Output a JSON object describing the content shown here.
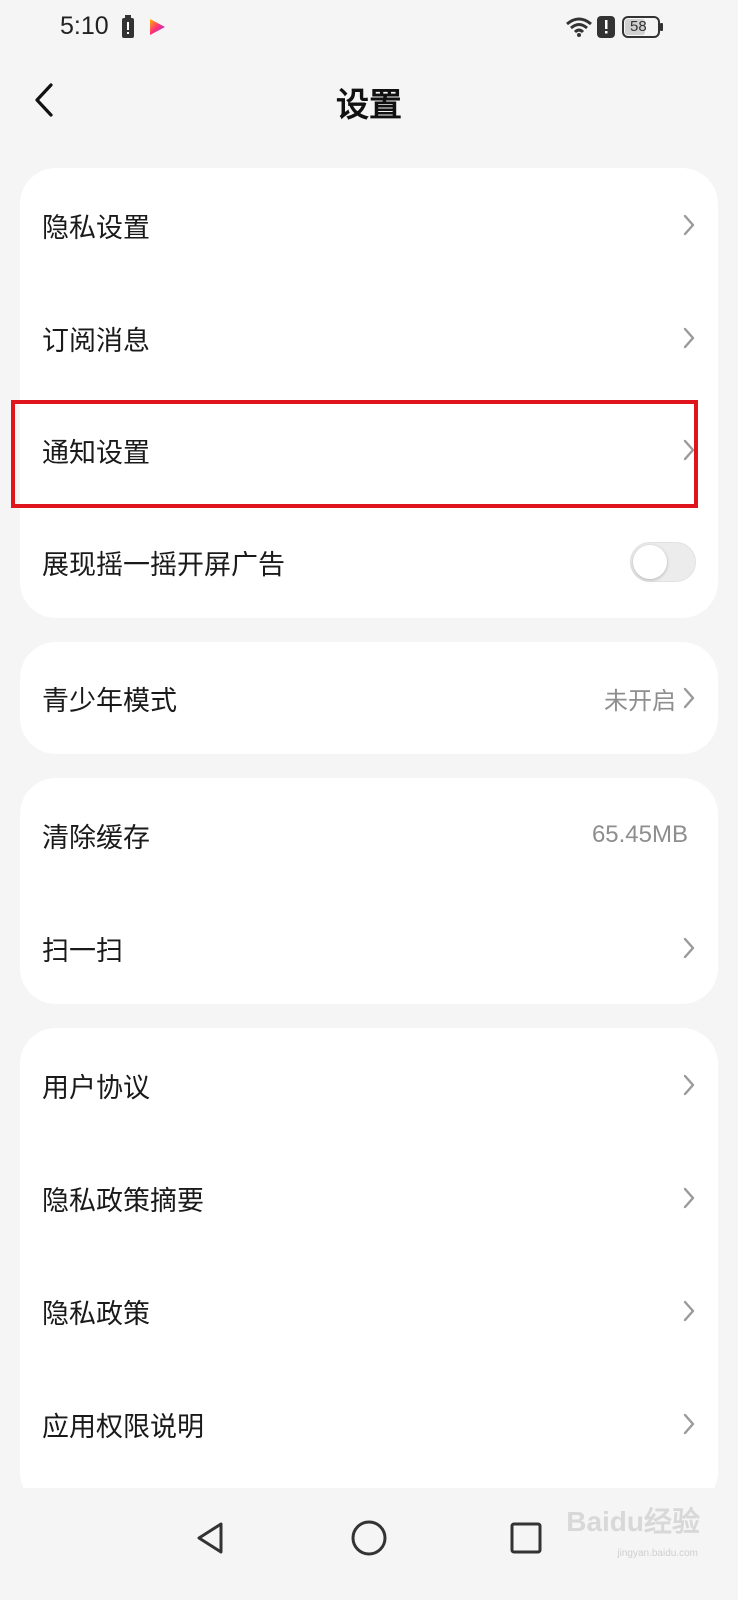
{
  "status_bar": {
    "time": "5:10",
    "battery": "58",
    "icons": [
      "battery-alert-icon",
      "video-app-icon",
      "wifi-icon",
      "alert-icon",
      "battery-icon"
    ]
  },
  "header": {
    "title": "设置",
    "back_icon": "chevron-left-icon"
  },
  "groups": [
    {
      "items": [
        {
          "label": "隐私设置",
          "type": "link"
        },
        {
          "label": "订阅消息",
          "type": "link"
        },
        {
          "label": "通知设置",
          "type": "link",
          "highlighted": true
        },
        {
          "label": "展现摇一摇开屏广告",
          "type": "toggle",
          "on": false
        }
      ]
    },
    {
      "items": [
        {
          "label": "青少年模式",
          "type": "link",
          "value": "未开启"
        }
      ]
    },
    {
      "items": [
        {
          "label": "清除缓存",
          "type": "value",
          "value": "65.45MB"
        },
        {
          "label": "扫一扫",
          "type": "link"
        }
      ]
    },
    {
      "items": [
        {
          "label": "用户协议",
          "type": "link"
        },
        {
          "label": "隐私政策摘要",
          "type": "link"
        },
        {
          "label": "隐私政策",
          "type": "link"
        },
        {
          "label": "应用权限说明",
          "type": "link"
        }
      ]
    }
  ],
  "nav_bar": {
    "buttons": [
      "back-triangle-icon",
      "home-circle-icon",
      "recents-square-icon"
    ]
  },
  "watermark": {
    "text": "Baidu经验",
    "sub": "jingyan.baidu.com"
  },
  "colors": {
    "background": "#f5f5f5",
    "card": "#ffffff",
    "highlight": "#e0141d",
    "secondary_text": "#8e8e8e"
  }
}
